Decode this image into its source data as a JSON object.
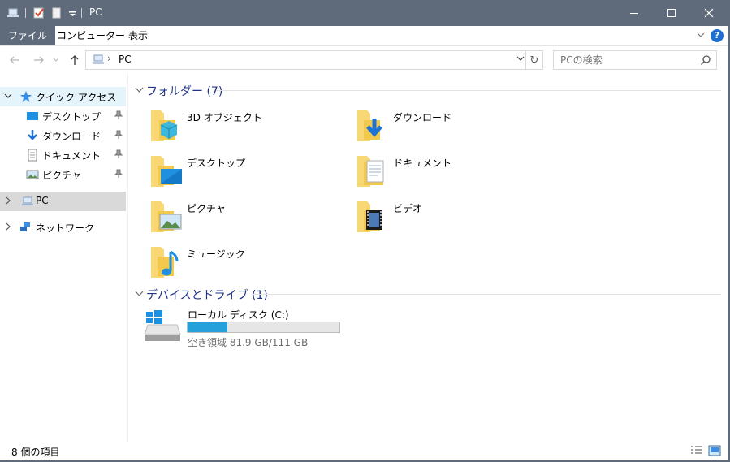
{
  "titlebar": {
    "title": "PC",
    "minimize_icon": "minimize-icon",
    "maximize_icon": "maximize-icon",
    "close_icon": "close-icon"
  },
  "ribbon": {
    "tabs": [
      {
        "label": "ファイル"
      },
      {
        "label": "コンピューター"
      },
      {
        "label": "表示"
      }
    ],
    "help_label": "?"
  },
  "address": {
    "path": "PC",
    "search_placeholder": "PCの検索"
  },
  "nav": {
    "quick_access": "クイック アクセス",
    "quick_items": [
      {
        "label": "デスクトップ"
      },
      {
        "label": "ダウンロード"
      },
      {
        "label": "ドキュメント"
      },
      {
        "label": "ピクチャ"
      }
    ],
    "pc": "PC",
    "network": "ネットワーク"
  },
  "content": {
    "folders_header": "フォルダー (7)",
    "folders": [
      {
        "label": "3D オブジェクト"
      },
      {
        "label": "ダウンロード"
      },
      {
        "label": "デスクトップ"
      },
      {
        "label": "ドキュメント"
      },
      {
        "label": "ピクチャ"
      },
      {
        "label": "ビデオ"
      },
      {
        "label": "ミュージック"
      }
    ],
    "drives_header": "デバイスとドライブ (1)",
    "drive": {
      "name": "ローカル ディスク (C:)",
      "space": "空き領域 81.9 GB/111 GB",
      "used_fraction": 0.26
    }
  },
  "status": {
    "item_count": "8 個の項目"
  },
  "colors": {
    "titlebar": "#5f6b7a",
    "accent_blue": "#1e3287",
    "drive_fill": "#26a0da",
    "folder_yellow": "#f8d775"
  }
}
